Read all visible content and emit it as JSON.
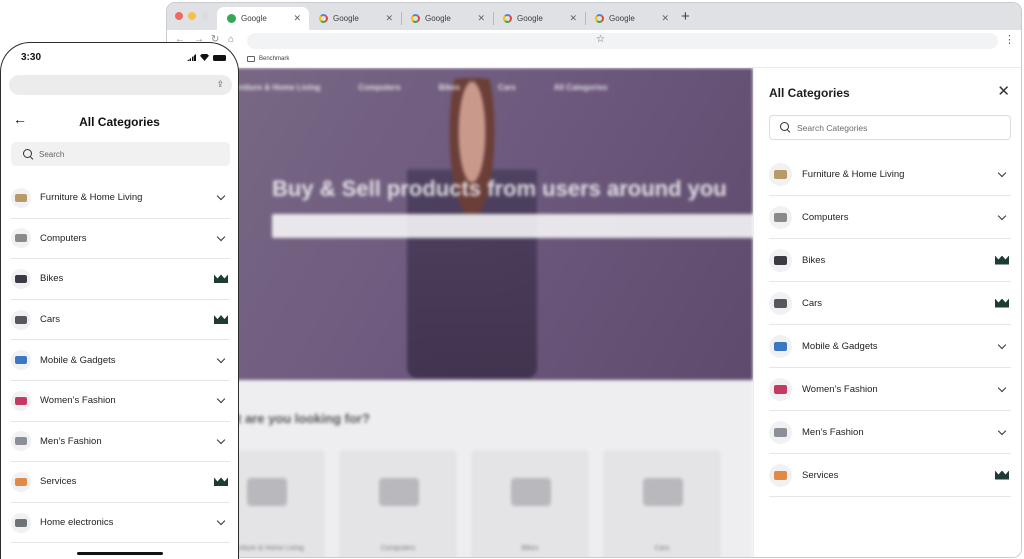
{
  "browser": {
    "tabs": [
      {
        "label": "Google",
        "active": true
      },
      {
        "label": "Google",
        "active": false
      },
      {
        "label": "Google",
        "active": false
      },
      {
        "label": "Google",
        "active": false
      },
      {
        "label": "Google",
        "active": false
      }
    ],
    "new_tab_label": "+",
    "bookmark_label": "Benchmark",
    "back_icon": "←",
    "forward_icon": "→",
    "reload_icon": "↻",
    "home_icon": "⌂",
    "star_icon": "☆",
    "menu_icon": "⋮"
  },
  "background_page": {
    "nav": [
      "Furniture & Home Living",
      "Computers",
      "Bikes",
      "Cars",
      "All Categories"
    ],
    "hero_title": "Buy & Sell products from users around you",
    "section_title": "t are you looking for?",
    "cards": [
      "Furniture & Home Living",
      "Computers",
      "Bikes",
      "Cars"
    ]
  },
  "panel": {
    "title": "All Categories",
    "close_icon": "✕",
    "search_placeholder": "Search Categories",
    "categories": [
      {
        "label": "Furniture & Home Living",
        "icon": "sofa-icon",
        "color": "#b89a6a",
        "action": "chevron"
      },
      {
        "label": "Computers",
        "icon": "computer-icon",
        "color": "#8a8a8a",
        "action": "chevron"
      },
      {
        "label": "Bikes",
        "icon": "bike-icon",
        "color": "#3a3a44",
        "action": "crown"
      },
      {
        "label": "Cars",
        "icon": "car-icon",
        "color": "#55585e",
        "action": "crown"
      },
      {
        "label": "Mobile & Gadgets",
        "icon": "phone-icon",
        "color": "#3a78c4",
        "action": "chevron"
      },
      {
        "label": "Women’s Fashion",
        "icon": "dress-icon",
        "color": "#c43a63",
        "action": "chevron"
      },
      {
        "label": "Men’s Fashion",
        "icon": "suit-icon",
        "color": "#8a8f98",
        "action": "chevron"
      },
      {
        "label": "Services",
        "icon": "services-icon",
        "color": "#e08a4a",
        "action": "crown"
      }
    ]
  },
  "phone": {
    "time": "3:30",
    "share_icon": "⇪",
    "title": "All Categories",
    "back_icon": "←",
    "search_placeholder": "Search",
    "categories": [
      {
        "label": "Furniture & Home Living",
        "icon": "sofa-icon",
        "color": "#b89a6a",
        "action": "chevron"
      },
      {
        "label": "Computers",
        "icon": "computer-icon",
        "color": "#8a8a8a",
        "action": "chevron"
      },
      {
        "label": "Bikes",
        "icon": "bike-icon",
        "color": "#3a3a44",
        "action": "crown"
      },
      {
        "label": "Cars",
        "icon": "car-icon",
        "color": "#55585e",
        "action": "crown"
      },
      {
        "label": "Mobile & Gadgets",
        "icon": "phone-icon",
        "color": "#3a78c4",
        "action": "chevron"
      },
      {
        "label": "Women’s Fashion",
        "icon": "dress-icon",
        "color": "#c43a63",
        "action": "chevron"
      },
      {
        "label": "Men’s Fashion",
        "icon": "suit-icon",
        "color": "#8a8f98",
        "action": "chevron"
      },
      {
        "label": "Services",
        "icon": "services-icon",
        "color": "#e08a4a",
        "action": "crown"
      },
      {
        "label": "Home electronics",
        "icon": "electronics-icon",
        "color": "#6f7378",
        "action": "chevron"
      }
    ]
  },
  "colors": {
    "crown": "#1f3b35",
    "panel_border": "#e6e6e6"
  }
}
